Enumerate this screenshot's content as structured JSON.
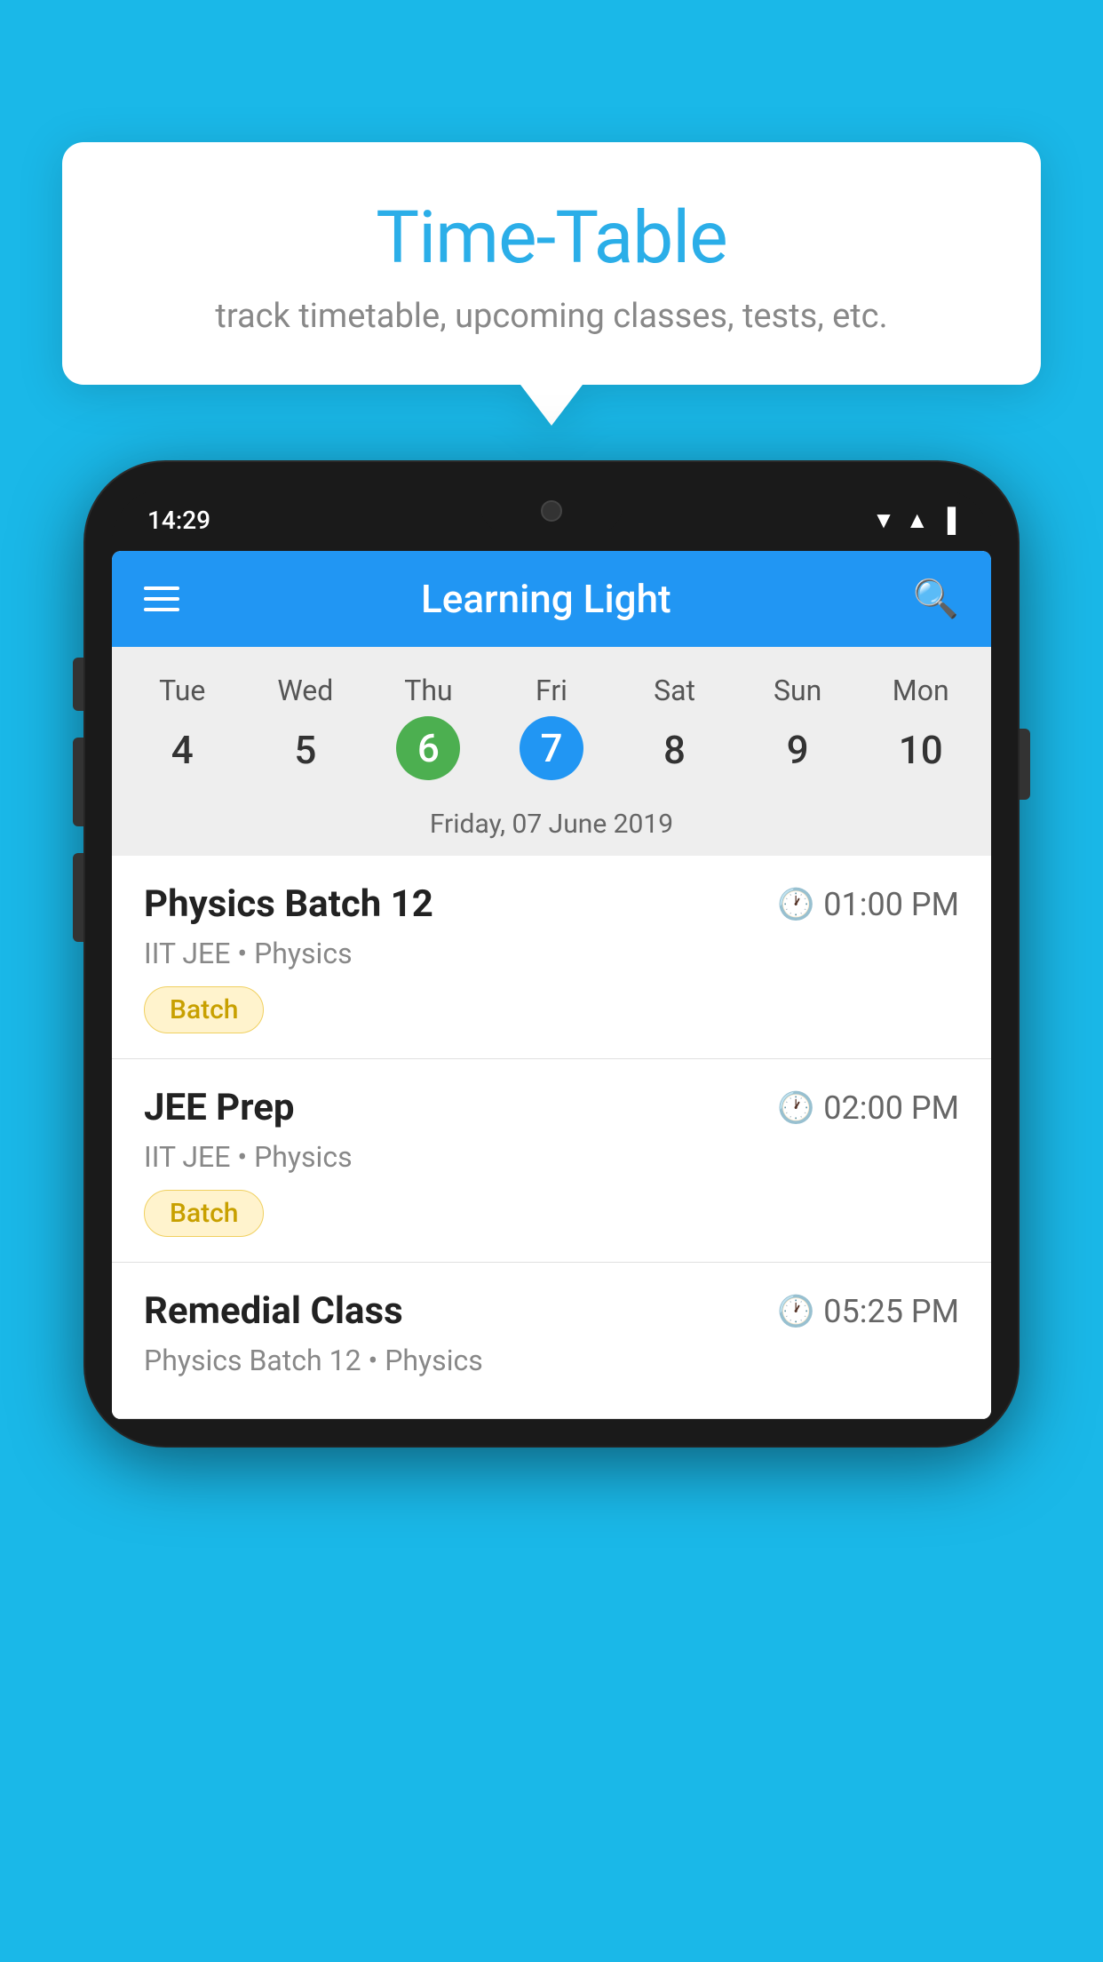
{
  "background_color": "#1ab8e8",
  "tooltip": {
    "title": "Time-Table",
    "subtitle": "track timetable, upcoming classes, tests, etc."
  },
  "phone": {
    "status_bar": {
      "time": "14:29"
    },
    "header": {
      "title": "Learning Light"
    },
    "calendar": {
      "days": [
        {
          "label": "Tue",
          "number": "4"
        },
        {
          "label": "Wed",
          "number": "5"
        },
        {
          "label": "Thu",
          "number": "6",
          "state": "today"
        },
        {
          "label": "Fri",
          "number": "7",
          "state": "selected"
        },
        {
          "label": "Sat",
          "number": "8"
        },
        {
          "label": "Sun",
          "number": "9"
        },
        {
          "label": "Mon",
          "number": "10"
        }
      ],
      "selected_date_label": "Friday, 07 June 2019"
    },
    "schedule": [
      {
        "title": "Physics Batch 12",
        "time": "01:00 PM",
        "subtitle": "IIT JEE • Physics",
        "badge": "Batch"
      },
      {
        "title": "JEE Prep",
        "time": "02:00 PM",
        "subtitle": "IIT JEE • Physics",
        "badge": "Batch"
      },
      {
        "title": "Remedial Class",
        "time": "05:25 PM",
        "subtitle": "Physics Batch 12 • Physics",
        "badge": null
      }
    ]
  }
}
